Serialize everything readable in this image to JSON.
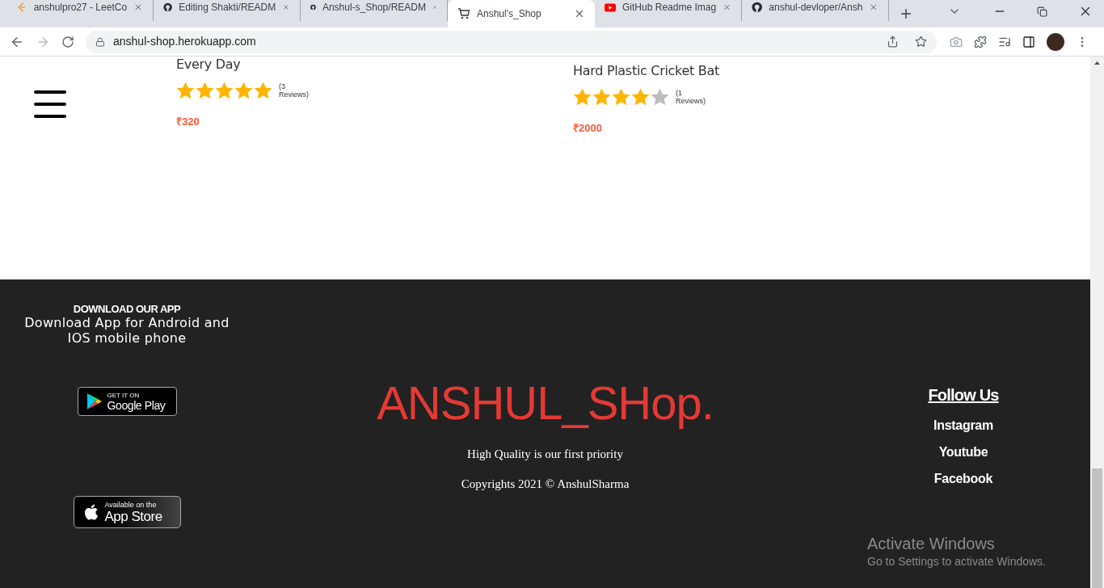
{
  "browser": {
    "tabs": [
      {
        "title": "anshulpro27 - LeetCo",
        "kind": "leetcode",
        "selected": false
      },
      {
        "title": "Editing Shakti/READM",
        "kind": "github",
        "selected": false
      },
      {
        "title": "Anshul-s_Shop/READM",
        "kind": "github",
        "selected": false
      },
      {
        "title": "Anshul's_Shop",
        "kind": "cart",
        "selected": true
      },
      {
        "title": "GitHub Readme Imag",
        "kind": "youtube",
        "selected": false
      },
      {
        "title": "anshul-devloper/Ansh",
        "kind": "github",
        "selected": false
      }
    ],
    "url": "anshul-shop.herokuapp.com"
  },
  "products": [
    {
      "title": "Every Day",
      "stars": 5,
      "reviews": "(3 Reviews)",
      "price": "₹320"
    },
    {
      "title": "Hard Plastic Cricket Bat",
      "stars": 4,
      "reviews": "(1 Reviews)",
      "price": "₹2000"
    }
  ],
  "footer": {
    "download": {
      "heading": "DOWNLOAD OUR APP",
      "text": "Download App for Android and IOS mobile phone",
      "google_play": {
        "small": "GET IT ON",
        "big": "Google Play"
      },
      "app_store": {
        "small": "Available on the",
        "big": "App Store"
      }
    },
    "brand": "ANSHUL_SHop.",
    "tagline": "High Quality is our first priority",
    "copyright": "Copyrights 2021 © AnshulSharma",
    "follow": {
      "heading": "Follow Us",
      "links": [
        "Instagram",
        "Youtube",
        "Facebook"
      ]
    }
  },
  "os_notice": {
    "title": "Activate Windows",
    "text": "Go to Settings to activate Windows."
  }
}
